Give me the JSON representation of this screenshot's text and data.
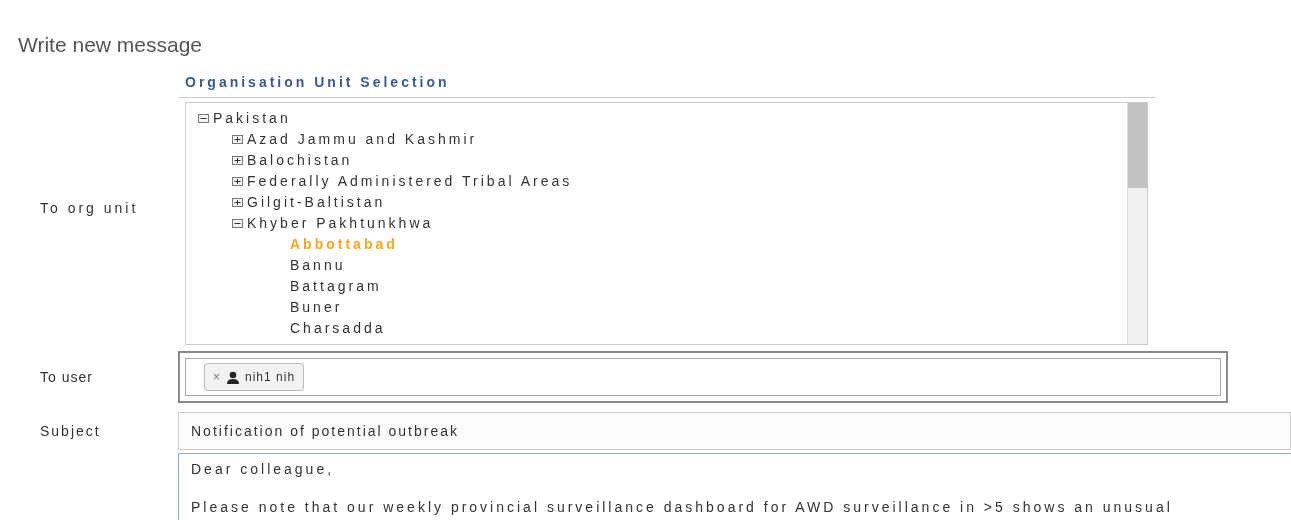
{
  "page_title": "Write new message",
  "org_unit": {
    "label": "To org unit",
    "heading": "Organisation Unit Selection",
    "tree": [
      {
        "label": "Pakistan",
        "expanded": true,
        "selected": false,
        "children": [
          {
            "label": "Azad Jammu and Kashmir",
            "expanded": false,
            "selected": false
          },
          {
            "label": "Balochistan",
            "expanded": false,
            "selected": false
          },
          {
            "label": "Federally Administered Tribal Areas",
            "expanded": false,
            "selected": false
          },
          {
            "label": "Gilgit-Baltistan",
            "expanded": false,
            "selected": false
          },
          {
            "label": "Khyber Pakhtunkhwa",
            "expanded": true,
            "selected": false,
            "children": [
              {
                "label": "Abbottabad",
                "selected": true
              },
              {
                "label": "Bannu",
                "selected": false
              },
              {
                "label": "Battagram",
                "selected": false
              },
              {
                "label": "Buner",
                "selected": false
              },
              {
                "label": "Charsadda",
                "selected": false
              }
            ]
          }
        ]
      }
    ]
  },
  "to_user": {
    "label": "To user",
    "tokens": [
      {
        "remove": "×",
        "name": "nih1 nih"
      }
    ]
  },
  "subject": {
    "label": "Subject",
    "value": "Notification of potential outbreak"
  },
  "message": {
    "value": "Dear colleague,\n\nPlease note that our weekly provincial surveillance dashboard for AWD surveillance in >5 shows an unusual"
  }
}
